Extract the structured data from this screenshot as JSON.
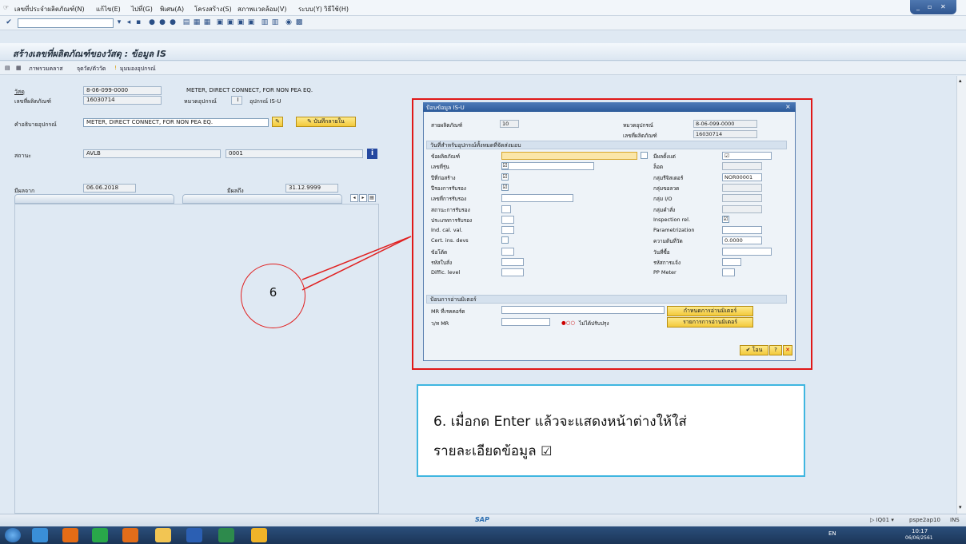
{
  "menu": [
    "เลขที่ประจำผลิตภัณฑ์(N)",
    "แก้ไข(E)",
    "ไปที่(G)",
    "พิเศษ(A)",
    "โครงสร้าง(S)",
    "สภาพแวดล้อม(V)",
    "ระบบ(Y)",
    "วิธีใช้(H)"
  ],
  "page_title": "สร้างเลขที่ผลิตภัณฑ์ของวัสดุ : ข้อมูล IS",
  "app_toolbar": {
    "overview": "ภาพรวมคลาส",
    "measure": "จุดวัด/ตัววัด",
    "device": "มุมมองอุปกรณ์"
  },
  "main": {
    "material_label": "วัสดุ",
    "material_value": "8-06-099-0000",
    "material_desc": "METER, DIRECT CONNECT, FOR NON PEA EQ.",
    "serial_label": "เลขที่ผลิตภัณฑ์",
    "serial_value": "16030714",
    "category_label": "หมวดอุปกรณ์",
    "category_value": "I",
    "category_text": "อุปกรณ์ IS-U",
    "desc_label": "คำอธิบายอุปกรณ์",
    "desc_value": "METER, DIRECT CONNECT, FOR NON PEA EQ.",
    "longtext_btn": "บันทึกลายใน",
    "status_label": "สถานะ",
    "status_value": "AVLB",
    "status_code": "0001",
    "valid_from_label": "มีผลจาก",
    "valid_from": "06.06.2018",
    "valid_to_label": "มีผลถึง",
    "valid_to": "31.12.9999"
  },
  "dialog": {
    "title": "ป้อนข้อมูล IS-U",
    "device_cat_label": "สายผลิตภัณฑ์",
    "device_cat_value": "10",
    "material_label": "หมวดอุปกรณ์",
    "material_value": "8-06-099-0000",
    "serial_label": "เลขที่ผลิตภัณฑ์",
    "serial_value": "16030714",
    "section1": "วันที่สำหรับอุปกรณ์ทั้งหมดที่จัดส่งมอบ",
    "left_fields": [
      "ข้อผลิตภัณฑ์",
      "เลขที่รุ่น",
      "ปีที่ก่อสร้าง",
      "ปีรองการรับรอง",
      "เลขที่การรับรอง",
      "สถานะการรับรอง",
      "ประเภทการรับรอง",
      "Ind. cal. val.",
      "Cert. ins. devs",
      "ข้อโต้ด",
      "รหัสใบสั่ง",
      "Diffic. level"
    ],
    "right_fields": [
      "มีผลตั้งแต่",
      "ล็อต",
      "กลุ่มรีจิสเตอร์",
      "กลุ่มขอลวด",
      "กลุ่ม I/O",
      "กลุ่มคำสั่ง",
      "Inspection rel.",
      "Parametrization",
      "ความต้นที่วัด",
      "วันที่ซื้อ",
      "รหัสการแจ้ง",
      "PP Meter"
    ],
    "register_group": "NOR00001",
    "measure_value": "0.0000",
    "section2": "ป้อนการอ่านมิเตอร์",
    "mr_label": "MR ที่เรคคอร์ด",
    "mr_date_label": "ว/ท MR",
    "not_updated": "ไม่ได้ปรับปรุง",
    "btn_define": "กำหนดการอ่านมิเตอร์",
    "btn_list": "รายการการอ่านมิเตอร์",
    "btn_ok": "โอน"
  },
  "callout_number": "6",
  "note_line1": "6. เมื่อกด Enter  แล้วจะแสดงหน้าต่างให้ใส่",
  "note_line2": "รายละเอียดข้อมูล",
  "status": {
    "system": "IQ01",
    "server": "pspe2ap10",
    "mode": "INS"
  },
  "tray": {
    "lang": "EN",
    "time": "10:17",
    "date": "06/06/2561"
  },
  "colors": {
    "accent": "#2c5a9a",
    "highlight": "#e01818",
    "note_border": "#3fb6e0"
  }
}
